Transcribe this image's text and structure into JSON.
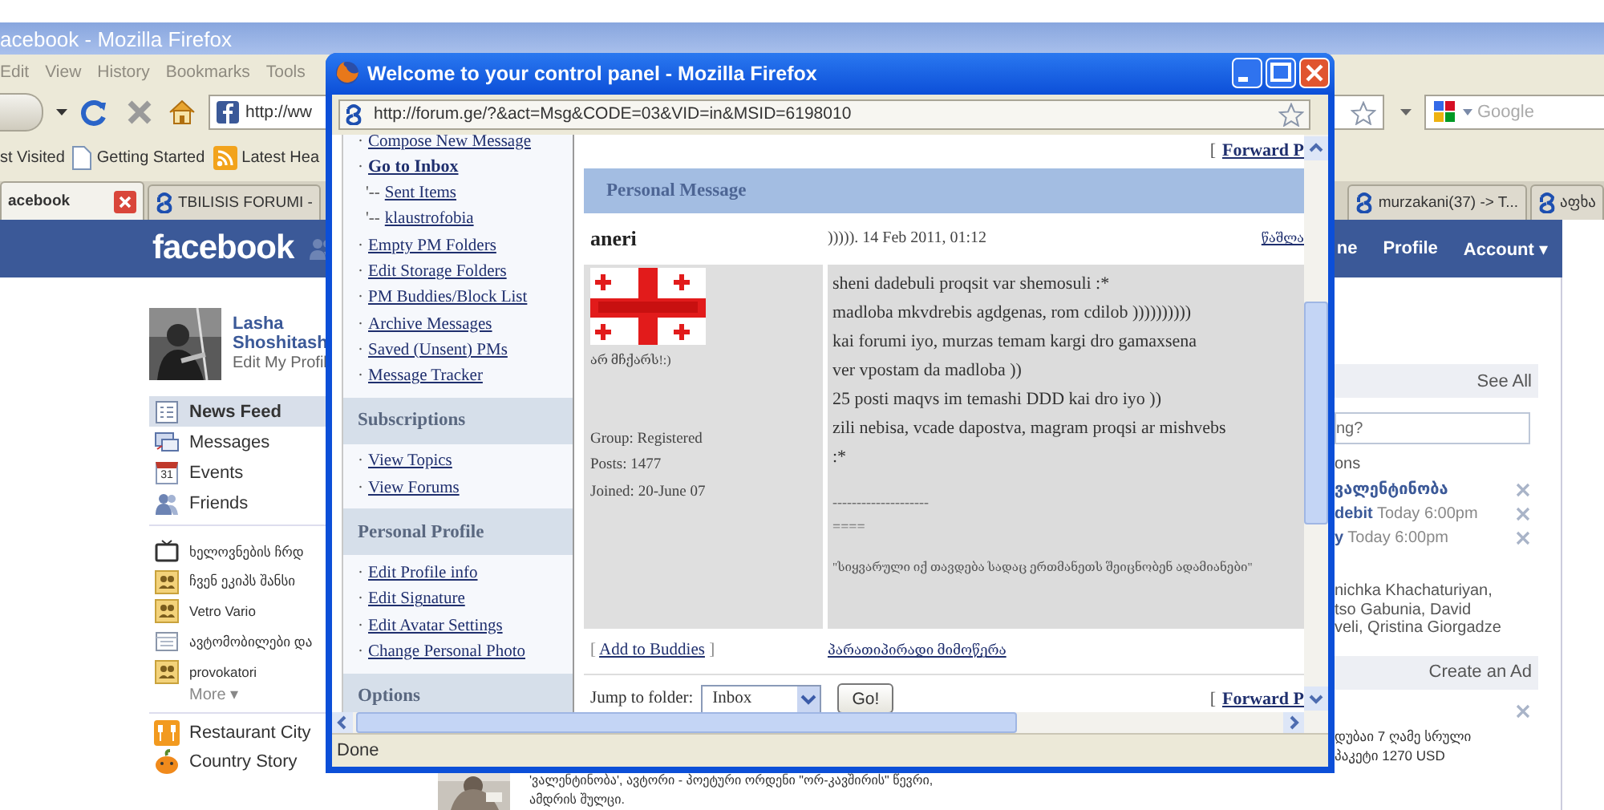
{
  "browser": {
    "title": "acebook - Mozilla Firefox",
    "menu": [
      "Edit",
      "View",
      "History",
      "Bookmarks",
      "Tools"
    ],
    "address": "http://ww",
    "search": {
      "placeholder": "Google"
    },
    "bookmarks": [
      {
        "label": "st Visited",
        "kind": "plain"
      },
      {
        "label": "Getting Started",
        "kind": "page"
      },
      {
        "label": "Latest Hea",
        "kind": "feed"
      }
    ],
    "tabs": [
      {
        "label": "acebook",
        "selected": true,
        "closable": true,
        "kind": "facebook"
      },
      {
        "label": "TBILISIS FORUMI -",
        "selected": false,
        "kind": "forum"
      },
      {
        "label": "murzakani(37) -> T...",
        "selected": false,
        "kind": "forum"
      },
      {
        "label": "აფხა",
        "selected": false,
        "kind": "forum"
      }
    ]
  },
  "facebook": {
    "logo": "facebook",
    "nav": [
      "ne",
      "Profile",
      "Account ▾"
    ],
    "profile": {
      "name": "Lasha Shoshitash",
      "edit_link": "Edit My Profil"
    },
    "menu": [
      {
        "label": "News Feed",
        "selected": true,
        "kind": "feed"
      },
      {
        "label": "Messages",
        "selected": false,
        "kind": "messages"
      },
      {
        "label": "Events",
        "selected": false,
        "kind": "events",
        "date": "31"
      },
      {
        "label": "Friends",
        "selected": false,
        "kind": "friends"
      }
    ],
    "groups": [
      {
        "label": "ხელოვნების ჩრდ",
        "kind": "tv"
      },
      {
        "label": "ჩვენ ეკიპს შანსი",
        "kind": "group"
      },
      {
        "label": "Vetro Vario",
        "kind": "group"
      },
      {
        "label": "ავტომობილები და",
        "kind": "page"
      },
      {
        "label": "provokatori",
        "kind": "group"
      }
    ],
    "more": "More ▾",
    "apps": [
      {
        "label": "Restaurant City",
        "kind": "restaurant"
      },
      {
        "label": "Country Story",
        "kind": "pumpkin"
      }
    ],
    "feed": {
      "lines": [
        "'ვალენტინობა', ავტორი - პოეტური ორდენი \"ორ-კავშირის\" წევრი,",
        "ამდრის შულცი."
      ]
    },
    "sidebar": {
      "see_all": "See All",
      "status_value": "ng?",
      "events_heading": "ons",
      "events": [
        {
          "name": "ვალენტინობა"
        },
        {
          "name": "debit",
          "time": "Today 6:00pm"
        },
        {
          "name": "y",
          "time": "Today 6:00pm"
        }
      ],
      "people": [
        "nichka Khachaturiyan,",
        "tso Gabunia, David",
        "veli, Qristina Giorgadze"
      ],
      "ads_heading": "Create an Ad",
      "ad_lines": [
        "დუბაი 7 ღამე სრული",
        "პაკეტი 1270 USD"
      ]
    }
  },
  "popup": {
    "title": "Welcome to your control panel - Mozilla Firefox",
    "address": "http://forum.ge/?&act=Msg&CODE=03&VID=in&MSID=6198010",
    "status": "Done",
    "sections": [
      {
        "links": [
          {
            "prefix": "·",
            "label": "Compose New Message",
            "selected": false
          },
          {
            "prefix": "·",
            "label": "Go to Inbox",
            "selected": true
          },
          {
            "prefix": "'--",
            "label": "Sent Items",
            "selected": false
          },
          {
            "prefix": "'--",
            "label": "klaustrofobia",
            "selected": false
          },
          {
            "prefix": "·",
            "label": "Empty PM Folders",
            "selected": false
          },
          {
            "prefix": "·",
            "label": "Edit Storage Folders",
            "selected": false
          },
          {
            "prefix": "·",
            "label": "PM Buddies/Block List",
            "selected": false
          },
          {
            "prefix": "·",
            "label": "Archive Messages",
            "selected": false
          },
          {
            "prefix": "·",
            "label": "Saved (Unsent) PMs",
            "selected": false
          },
          {
            "prefix": "·",
            "label": "Message Tracker",
            "selected": false
          }
        ]
      },
      {
        "heading": "Subscriptions",
        "links": [
          {
            "prefix": "·",
            "label": "View Topics",
            "selected": false
          },
          {
            "prefix": "·",
            "label": "View Forums",
            "selected": false
          }
        ]
      },
      {
        "heading": "Personal Profile",
        "links": [
          {
            "prefix": "·",
            "label": "Edit Profile info",
            "selected": false
          },
          {
            "prefix": "·",
            "label": "Edit Signature",
            "selected": false
          },
          {
            "prefix": "·",
            "label": "Edit Avatar Settings",
            "selected": false
          },
          {
            "prefix": "·",
            "label": "Change Personal Photo",
            "selected": false
          }
        ]
      },
      {
        "heading": "Options"
      }
    ],
    "message": {
      "forward_top": {
        "bracket": "[",
        "label": "Forward P"
      },
      "header": "Personal Message",
      "sender": "aneri",
      "date": "))))). 14 Feb 2011, 01:12",
      "delete": "წაშლა",
      "avatar_caption": "არ მჩქარს!:)",
      "info": [
        "Group: Registered",
        "Posts: 1477",
        "Joined: 20-June 07"
      ],
      "body": [
        "sheni dadebuli proqsit var shemosuli :*",
        "madloba mkvdrebis agdgenas, rom cdilob ))))))))))",
        "kai forumi iyo, murzas temam kargi dro gamaxsena",
        "ver vpostam da madloba ))",
        "25 posti maqvs im temashi DDD kai dro iyo ))",
        "zili nebisa, vcade dapostva, magram proqsi ar mishvebs",
        ":*"
      ],
      "signature_rules": [
        "--------------------",
        "===="
      ],
      "signature": "\"სიყვარული იქ თავდება სადაც ერთმანეთს შეიცნობენ ადამიანები\"",
      "add_buddy": {
        "open": "[",
        "label": "Add to Buddies",
        "close": "]"
      },
      "reply": "პარათიპირადი მიმოწერა",
      "jump_label": "Jump to folder:",
      "folder": "Inbox",
      "go": "Go!",
      "forward_bottom": {
        "bracket": "[",
        "label": "Forward P"
      }
    }
  }
}
